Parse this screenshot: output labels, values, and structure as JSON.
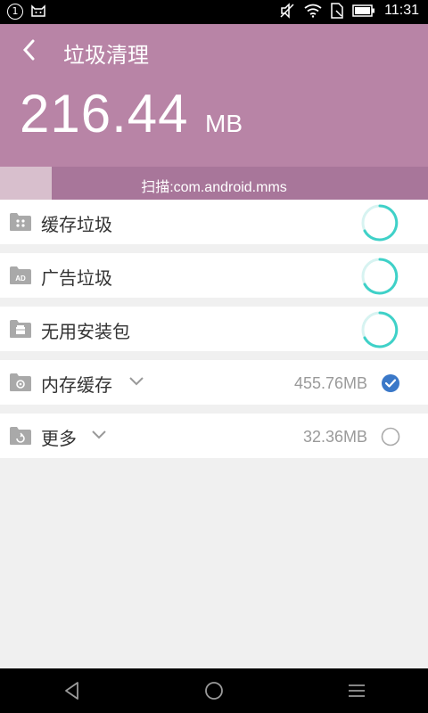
{
  "status_bar": {
    "notification_count": "1",
    "time": "11:31"
  },
  "header": {
    "title": "垃圾清理",
    "size_value": "216.44",
    "size_unit": "MB"
  },
  "scan": {
    "text": "扫描:com.android.mms",
    "progress_fraction": 0.12
  },
  "categories": [
    {
      "label": "缓存垃圾",
      "state": "scanning"
    },
    {
      "label": "广告垃圾",
      "state": "scanning"
    },
    {
      "label": "无用安装包",
      "state": "scanning"
    },
    {
      "label": "内存缓存",
      "size": "455.76MB",
      "checked": true,
      "expandable": true
    },
    {
      "label": "更多",
      "size": "32.36MB",
      "checked": false,
      "expandable": true
    }
  ],
  "colors": {
    "header": "#b884a6",
    "scan_bar": "#a8769a",
    "spinner": "#3fd1c8",
    "check": "#3a78c8"
  },
  "nav": [
    "back-icon",
    "home-icon",
    "menu-icon"
  ]
}
